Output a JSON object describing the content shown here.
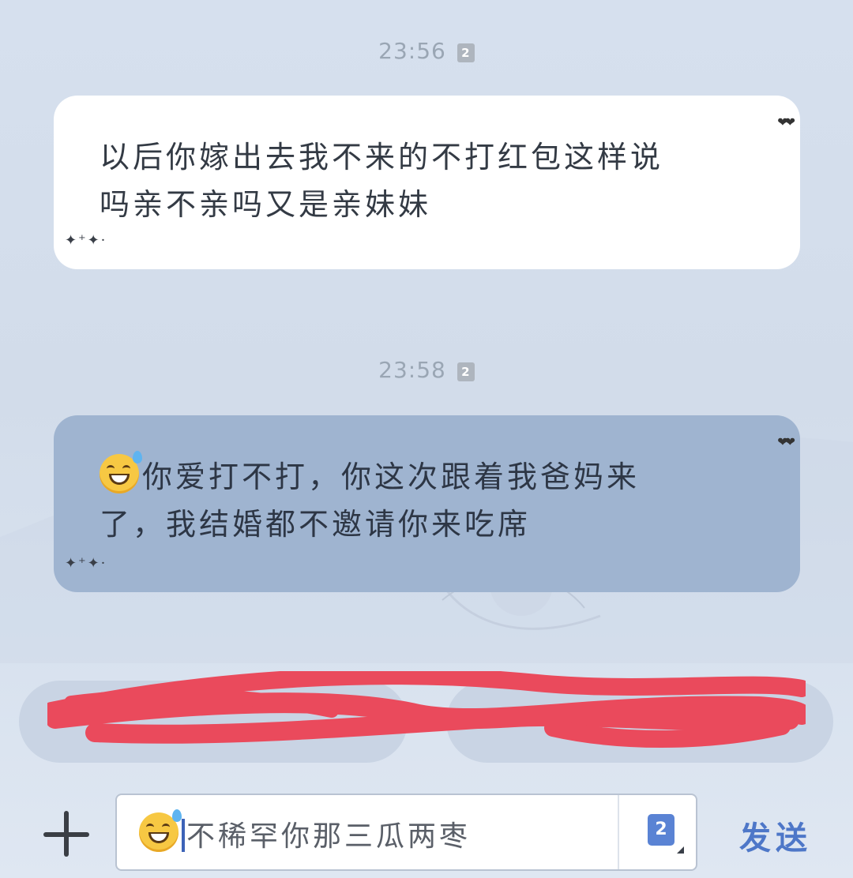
{
  "chat": {
    "messages": [
      {
        "time": "23:56",
        "time_tag": "2",
        "side": "incoming",
        "line1": "以后你嫁出去我不来的不打红包这样说",
        "line2": "吗亲不亲吗又是亲妹妹"
      },
      {
        "time": "23:58",
        "time_tag": "2",
        "side": "outgoing",
        "emoji": "grinning-sweat-emoji",
        "line1": "你爱打不打，你这次跟着我爸妈来",
        "line2": "了，我结婚都不邀请你来吃席"
      }
    ],
    "decor": {
      "hearts": "❤❤",
      "sparkles": "✦⁺✦·"
    }
  },
  "quick_replies": {
    "redacted": true
  },
  "composer": {
    "plus_icon": "plus-icon",
    "emoji": "grinning-sweat-emoji",
    "input_value": "不稀罕你那三瓜两枣",
    "doc_badge": "2",
    "send_label": "发送"
  },
  "colors": {
    "incoming_bubble": "#ffffff",
    "outgoing_bubble": "#9fb4d0",
    "send_text": "#4e77c8",
    "scribble": "#ea4a5c"
  }
}
